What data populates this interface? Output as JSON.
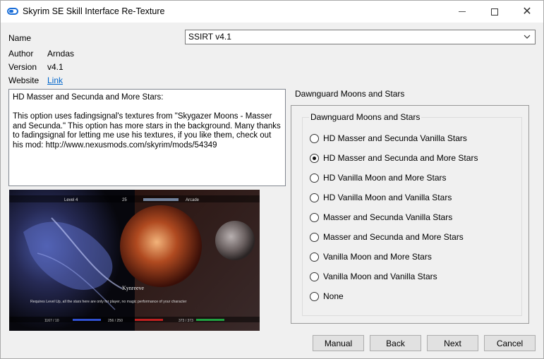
{
  "window": {
    "title": "Skyrim SE Skill Interface Re-Texture"
  },
  "info": {
    "name_label": "Name",
    "author_label": "Author",
    "author_value": "Arndas",
    "version_label": "Version",
    "version_value": "v4.1",
    "website_label": "Website",
    "website_link": "Link"
  },
  "name_select": {
    "value": "SSIRT v4.1"
  },
  "description": "HD Masser and Secunda and More Stars:\n\nThis option uses fadingsignal's textures from \"Skygazer Moons - Masser and Secunda.\" This option has more stars in the background. Many thanks to fadingsignal for letting me use his textures, if you like them, check out his mod: http://www.nexusmods.com/skyrim/mods/54349",
  "preview": {
    "hud_left": "Level 4",
    "hud_mid": "25",
    "hud_right": "Arcade",
    "center_word": "Kynreeve",
    "caption": "Requires Level Up, all the stars here are only for player, no magic performance of your character",
    "bottom_left": "1167 / 10",
    "bottom_mid": "256 / 250",
    "bottom_right": "373 / 373"
  },
  "group": {
    "outer_label": "Dawnguard Moons and Stars",
    "inner_label": "Dawnguard Moons and Stars",
    "options": [
      {
        "label": "HD Masser and Secunda Vanilla Stars",
        "checked": false
      },
      {
        "label": "HD Masser and Secunda and More Stars",
        "checked": true
      },
      {
        "label": "HD Vanilla Moon and More Stars",
        "checked": false
      },
      {
        "label": "HD Vanilla Moon and Vanilla Stars",
        "checked": false
      },
      {
        "label": "Masser and Secunda Vanilla Stars",
        "checked": false
      },
      {
        "label": "Masser and Secunda and More Stars",
        "checked": false
      },
      {
        "label": "Vanilla Moon and More Stars",
        "checked": false
      },
      {
        "label": "Vanilla Moon and Vanilla Stars",
        "checked": false
      },
      {
        "label": "None",
        "checked": false
      }
    ]
  },
  "buttons": {
    "manual": "Manual",
    "back": "Back",
    "next": "Next",
    "cancel": "Cancel"
  }
}
